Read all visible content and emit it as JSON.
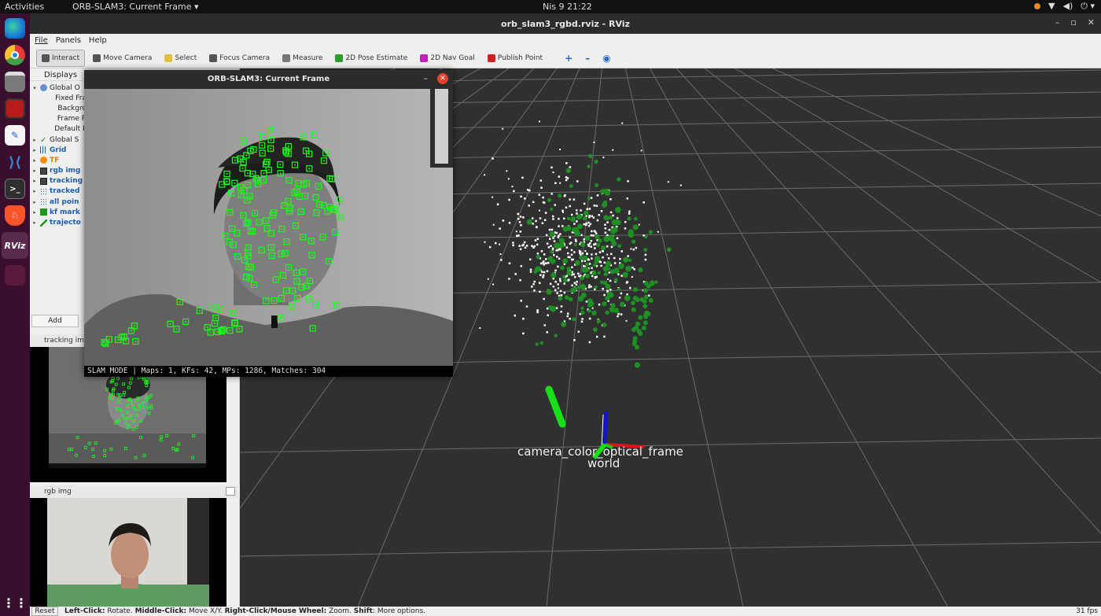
{
  "system": {
    "activities": "Activities",
    "app_menu": "ORB-SLAM3: Current Frame ▾",
    "clock": "Nis 9  21:22",
    "tray": [
      "●",
      "▼",
      "◀)",
      "⏻ ▾"
    ]
  },
  "dock": {
    "items": [
      "edge-browser",
      "chrome",
      "files",
      "terminal-red",
      "text-editor",
      "vscode",
      "terminal",
      "brave",
      "rviz"
    ]
  },
  "rviz": {
    "window_title": "orb_slam3_rgbd.rviz - RViz",
    "window_controls": [
      "–",
      "▫",
      "✕"
    ],
    "menu": [
      "File",
      "Panels",
      "Help"
    ],
    "toolbar": [
      {
        "label": "Interact",
        "active": true,
        "color": "#555"
      },
      {
        "label": "Move Camera",
        "active": false,
        "color": "#555"
      },
      {
        "label": "Select",
        "active": false,
        "color": "#e0c040"
      },
      {
        "label": "Focus Camera",
        "active": false,
        "color": "#555"
      },
      {
        "label": "Measure",
        "active": false,
        "color": "#777"
      },
      {
        "label": "2D Pose Estimate",
        "active": false,
        "color": "#2aa02a"
      },
      {
        "label": "2D Nav Goal",
        "active": false,
        "color": "#c020c0"
      },
      {
        "label": "Publish Point",
        "active": false,
        "color": "#d02020"
      }
    ],
    "toolbar_extra": [
      "+",
      "–",
      "◉"
    ],
    "displays_title": "Displays",
    "displays": [
      {
        "label": "Global O",
        "style": "plain",
        "arrow": "▾",
        "icon": "gear"
      },
      {
        "label": "Fixed Fra",
        "style": "plain",
        "arrow": "",
        "icon": ""
      },
      {
        "label": "Backgro",
        "style": "plain",
        "arrow": "",
        "icon": ""
      },
      {
        "label": "Frame R",
        "style": "plain",
        "arrow": "",
        "icon": ""
      },
      {
        "label": "Default L",
        "style": "plain",
        "arrow": "",
        "icon": ""
      },
      {
        "label": "Global S",
        "style": "plain",
        "arrow": "▸",
        "icon": "check"
      },
      {
        "label": "Grid",
        "style": "blue",
        "arrow": "▸",
        "icon": "grid"
      },
      {
        "label": "TF",
        "style": "orange",
        "arrow": "▸",
        "icon": "tf"
      },
      {
        "label": "rgb img",
        "style": "blue",
        "arrow": "▸",
        "icon": "image"
      },
      {
        "label": "tracking",
        "style": "blue",
        "arrow": "▸",
        "icon": "image"
      },
      {
        "label": "tracked",
        "style": "blue",
        "arrow": "▸",
        "icon": "points"
      },
      {
        "label": "all poin",
        "style": "blue",
        "arrow": "▸",
        "icon": "points"
      },
      {
        "label": "kf mark",
        "style": "blue",
        "arrow": "▸",
        "icon": "cube"
      },
      {
        "label": "trajecto",
        "style": "blue",
        "arrow": "▸",
        "icon": "path"
      }
    ],
    "add_button": "Add",
    "tracking_panel_title": "tracking img",
    "rgb_panel_title": "rgb img",
    "frame_labels": [
      "camera_color_optical_frame",
      "world"
    ],
    "status": {
      "reset": "Reset",
      "hint_parts": [
        {
          "text": "Left-Click:",
          "bold": true
        },
        {
          "text": " Rotate. ",
          "bold": false
        },
        {
          "text": "Middle-Click:",
          "bold": true
        },
        {
          "text": " Move X/Y. ",
          "bold": false
        },
        {
          "text": "Right-Click/Mouse Wheel:",
          "bold": true
        },
        {
          "text": " Zoom. ",
          "bold": false
        },
        {
          "text": "Shift",
          "bold": true
        },
        {
          "text": ": More options.",
          "bold": false
        }
      ],
      "fps": "31 fps"
    }
  },
  "orb_window": {
    "title": "ORB-SLAM3: Current Frame",
    "status_text": "SLAM MODE |  Maps: 1, KFs: 42, MPs: 1286, Matches: 304"
  }
}
